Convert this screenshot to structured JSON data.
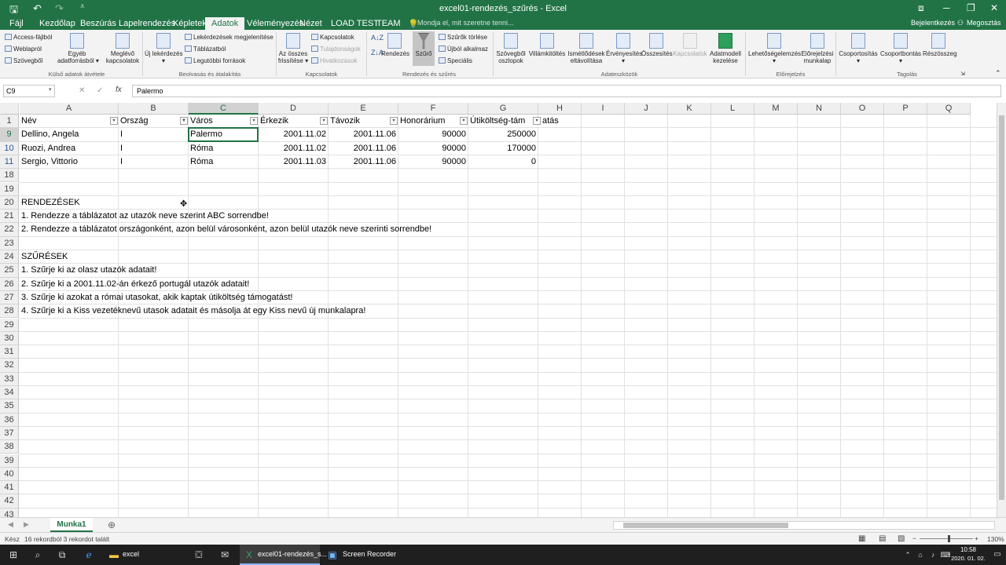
{
  "window": {
    "title": "excel01-rendezés_szűrés - Excel",
    "quick_access": {
      "save": "🖫",
      "undo": "↶",
      "redo": "↷",
      "customize": "⩡"
    },
    "controls": {
      "ribbon_display": "⧈",
      "minimize": "─",
      "restore": "❐",
      "close": "✕"
    }
  },
  "tabs": [
    "Fájl",
    "Kezdőlap",
    "Beszúrás",
    "Lapelrendezés",
    "Képletek",
    "Adatok",
    "Véleményezés",
    "Nézet",
    "LOAD TEST",
    "TEAM"
  ],
  "tell_me": "Mondja el, mit szeretne tenni...",
  "account": {
    "signin": "Bejelentkezés",
    "share": "Megosztás"
  },
  "ribbon": {
    "external": {
      "access": "Access-fájlból",
      "web": "Weblapról",
      "text": "Szövegből",
      "other_l1": "Egyéb",
      "other_l2": "adatforrásból ▾",
      "existing_l1": "Meglévő",
      "existing_l2": "kapcsolatok",
      "group": "Külső adatok átvétele"
    },
    "transform": {
      "new_query_l1": "Új lekérdezés",
      "new_query_l2": "▾",
      "show_queries": "Lekérdezések megjelenítése",
      "from_table": "Táblázatból",
      "recent": "Legutóbbi források",
      "group": "Beolvasás és átalakítás"
    },
    "connections": {
      "refresh_l1": "Az összes",
      "refresh_l2": "frissítése ▾",
      "conn": "Kapcsolatok",
      "props": "Tulajdonságok",
      "links": "Hivatkozások",
      "group": "Kapcsolatok"
    },
    "sortfilter": {
      "sort": "Rendezés",
      "filter": "Szűrő",
      "clear": "Szűrők törlése",
      "reapply": "Újból alkalmaz",
      "advanced": "Speciális",
      "group": "Rendezés és szűrés"
    },
    "tools": {
      "t2c_l1": "Szövegből",
      "t2c_l2": "oszlopok",
      "flash": "Villámkitöltés",
      "dup_l1": "Ismétlődések",
      "dup_l2": "eltávolítása",
      "valid_l1": "Érvényesítés",
      "valid_l2": "▾",
      "consol": "Összesítés",
      "rel": "Kapcsolatok",
      "model_l1": "Adatmodell",
      "model_l2": "kezelése",
      "group": "Adateszközök"
    },
    "forecast": {
      "whatif_l1": "Lehetőségelemzés",
      "whatif_l2": "▾",
      "sheet_l1": "Előrejelzési",
      "sheet_l2": "munkalap",
      "group": "Előrejelzés"
    },
    "outline": {
      "group_btn": "Csoportosítás",
      "group_arrow": "▾",
      "ungroup": "Csoportbontás",
      "ungroup_arrow": "▾",
      "subtotal": "Részösszeg",
      "group": "Tagolás"
    }
  },
  "formula_bar": {
    "name_box": "C9",
    "cancel": "✕",
    "enter": "✓",
    "fx": "fx",
    "content": "Palermo"
  },
  "columns": [
    "A",
    "B",
    "C",
    "D",
    "E",
    "F",
    "G",
    "H",
    "I",
    "J",
    "K",
    "L",
    "M",
    "N",
    "O",
    "P",
    "Q"
  ],
  "rows": [
    "1",
    "9",
    "10",
    "11",
    "18",
    "19",
    "20",
    "21",
    "22",
    "23",
    "24",
    "25",
    "26",
    "27",
    "28",
    "29",
    "30",
    "31",
    "32",
    "33",
    "34",
    "35",
    "36",
    "37",
    "38",
    "39",
    "40",
    "41",
    "42",
    "43"
  ],
  "headers": [
    "Név",
    "Ország",
    "Város",
    "Érkezik",
    "Távozik",
    "Honorárium",
    "Útiköltség-tám",
    "atás"
  ],
  "data": [
    [
      "Dellino, Angela",
      "I",
      "Palermo",
      "2001.11.02",
      "2001.11.06",
      "90000",
      "250000"
    ],
    [
      "Ruozi, Andrea",
      "I",
      "Róma",
      "2001.11.02",
      "2001.11.06",
      "90000",
      "170000"
    ],
    [
      "Sergio, Vittorio",
      "I",
      "Róma",
      "2001.11.03",
      "2001.11.06",
      "90000",
      "0"
    ]
  ],
  "notes": [
    "RENDEZÉSEK",
    "1. Rendezze a táblázatot az utazók neve szerint ABC sorrendbe!",
    "2. Rendezze a táblázatot országonként, azon belül városonként, azon belül utazók neve szerinti sorrendbe!",
    "SZŰRÉSEK",
    "1. Szűrje ki az olasz utazók adatait!",
    "2. Szűrje ki a 2001.11.02-án érkező portugál utazók adatait!",
    "3. Szűrje ki azokat a római utasokat, akik kaptak útiköltség támogatást!",
    "4. Szűrje ki a Kiss vezetéknevű utasok adatait és másolja át egy Kiss nevű új munkalapra!"
  ],
  "sheet_tab": "Munka1",
  "add_sheet": "⊕",
  "status": {
    "mode": "Kész",
    "filter_msg": "16 rekordból 3 rekordot talált",
    "zoom": "130%",
    "minus": "−",
    "plus": "+"
  },
  "taskbar": {
    "excel_folder": "excel",
    "excel_window": "excel01-rendezés_s...",
    "recorder": "Screen Recorder",
    "time": "10:58",
    "date": "2020. 01. 02."
  }
}
